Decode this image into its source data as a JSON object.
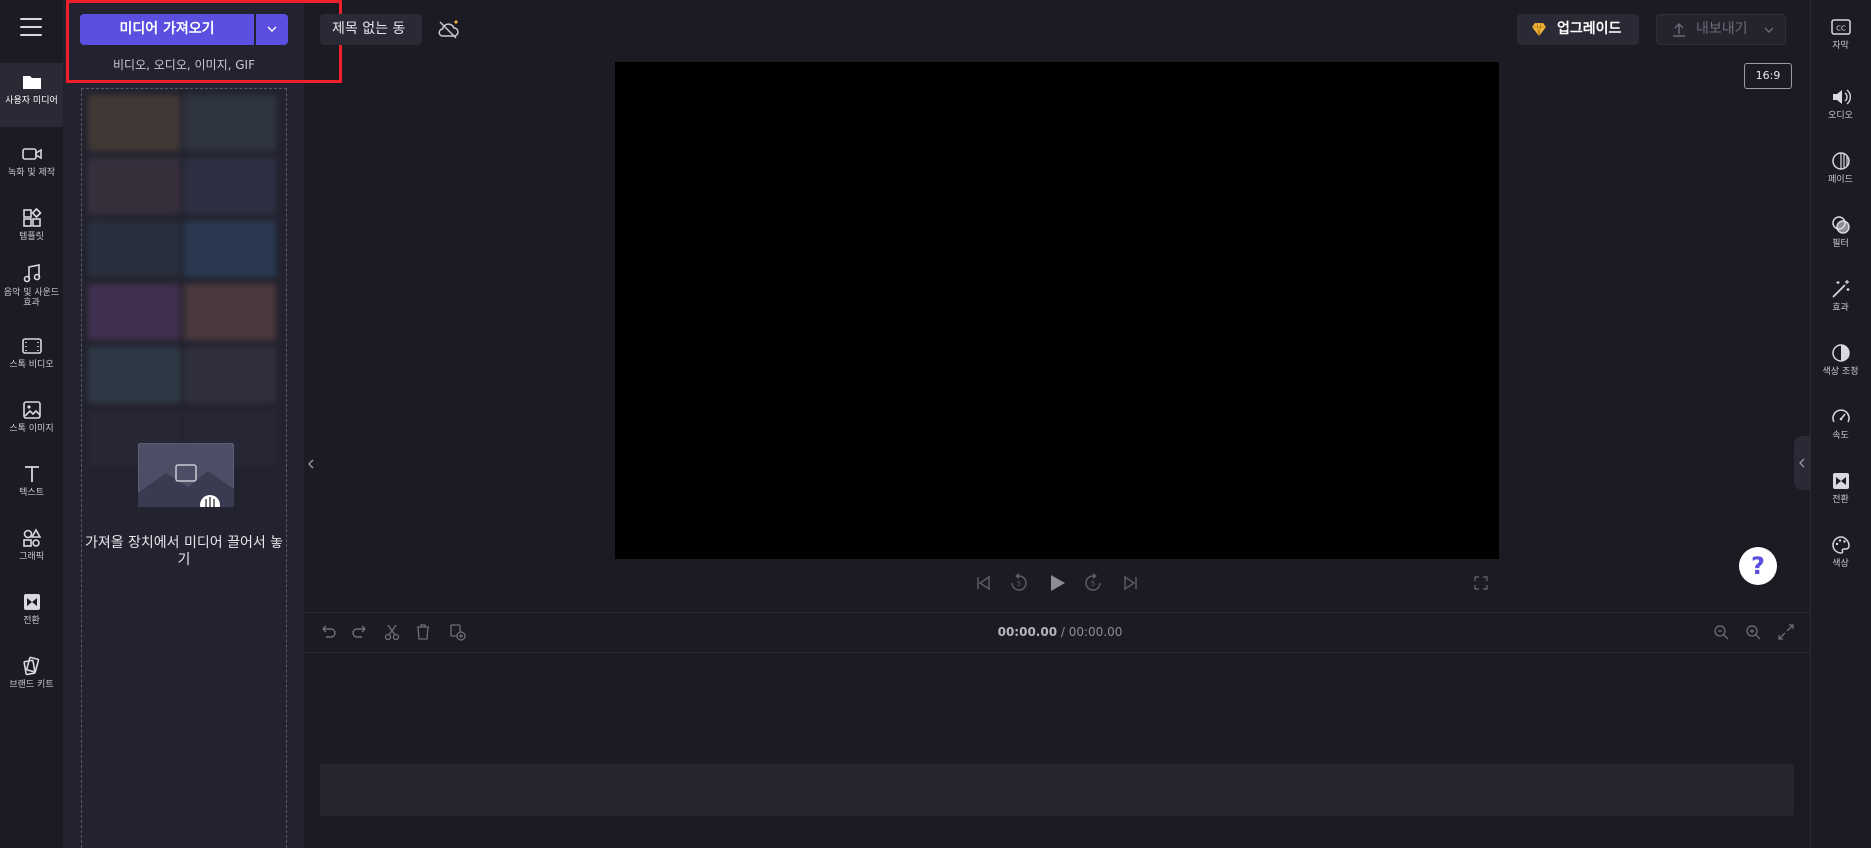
{
  "left_nav": {
    "items": [
      {
        "label": "사용자 미디어",
        "icon": "folder-icon"
      },
      {
        "label": "녹화 및 제작",
        "icon": "video-camera-icon"
      },
      {
        "label": "템플릿",
        "icon": "templates-icon"
      },
      {
        "label": "음악 및 사운드 효과",
        "icon": "music-note-icon"
      },
      {
        "label": "스톡 비디오",
        "icon": "film-icon"
      },
      {
        "label": "스톡 이미지",
        "icon": "image-icon"
      },
      {
        "label": "텍스트",
        "icon": "text-icon"
      },
      {
        "label": "그래픽",
        "icon": "shapes-icon"
      },
      {
        "label": "전환",
        "icon": "transition-icon"
      },
      {
        "label": "브랜드 키트",
        "icon": "brand-kit-icon"
      }
    ]
  },
  "media_panel": {
    "import_label": "미디어 가져오기",
    "import_subtitle": "비디오, 오디오, 이미지, GIF",
    "dropzone_text": "가져올 장치에서 미디어 끌어서 놓기"
  },
  "top_bar": {
    "project_title": "제목 없는 동",
    "upgrade_label": "업그레이드",
    "export_label": "내보내기",
    "aspect_ratio": "16:9"
  },
  "timeline": {
    "current_time": "00:00.00",
    "separator": " / ",
    "total_time": "00:00.00"
  },
  "help_label": "?",
  "right_nav": {
    "items": [
      {
        "label": "자막",
        "icon": "captions-icon"
      },
      {
        "label": "오디오",
        "icon": "speaker-icon"
      },
      {
        "label": "페이드",
        "icon": "fade-icon"
      },
      {
        "label": "필터",
        "icon": "filter-icon"
      },
      {
        "label": "효과",
        "icon": "magic-wand-icon"
      },
      {
        "label": "색상 조정",
        "icon": "contrast-icon"
      },
      {
        "label": "속도",
        "icon": "speedometer-icon"
      },
      {
        "label": "전환",
        "icon": "transition-icon"
      },
      {
        "label": "색상",
        "icon": "palette-icon"
      }
    ]
  },
  "colors": {
    "accent": "#5a4fe0",
    "highlight_border": "#ef1f2c",
    "background": "#1b1b23",
    "panel": "#23232f"
  }
}
